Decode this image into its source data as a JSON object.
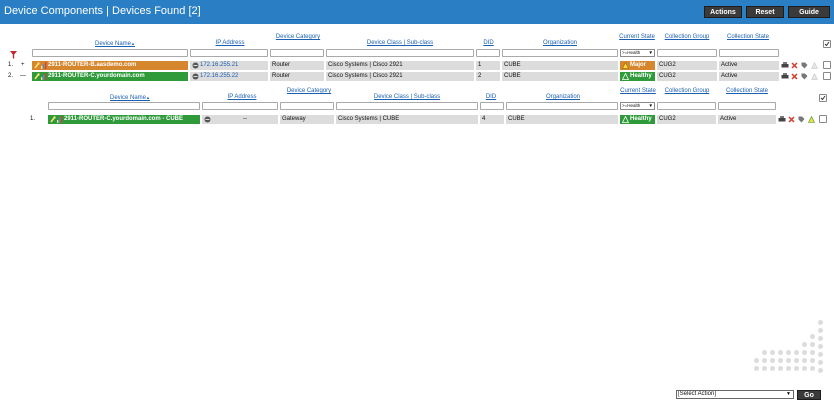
{
  "header": {
    "title": "Device Components | Devices Found [2]",
    "buttons": {
      "actions": "Actions",
      "reset": "Reset",
      "guide": "Guide"
    }
  },
  "table": {
    "columns": {
      "device_name": "Device Name",
      "sort_marker": "▲",
      "ip": "IP Address",
      "category": "Device Category",
      "class": "Device Class | Sub-class",
      "did": "DID",
      "org": "Organization",
      "current_state": "Current State",
      "collection_group": "Collection Group",
      "collection_state": "Collection State"
    },
    "state_filter": ">=Health",
    "rows": [
      {
        "num": "1.",
        "toggle": "+",
        "name": "2911-ROUTER-B.aasdemo.com",
        "ip": "172.16.255.21",
        "category": "Router",
        "class": "Cisco Systems | Cisco 2921",
        "did": "1",
        "org": "CUBE",
        "state": "Major",
        "group": "CUG2",
        "cstate": "Active"
      },
      {
        "num": "2.",
        "toggle": "—",
        "name": "2911-ROUTER-C.yourdomain.com",
        "ip": "172.16.255.22",
        "category": "Router",
        "class": "Cisco Systems | Cisco 2921",
        "did": "2",
        "org": "CUBE",
        "state": "Healthy",
        "group": "CUG2",
        "cstate": "Active"
      }
    ]
  },
  "subtable": {
    "columns": {
      "device_name": "Device Name",
      "sort_marker": "▲",
      "ip": "IP Address",
      "category": "Device Category",
      "class": "Device Class | Sub-class",
      "did": "DID",
      "org": "Organization",
      "current_state": "Current State",
      "collection_group": "Collection Group",
      "collection_state": "Collection State"
    },
    "state_filter": ">=Health",
    "rows": [
      {
        "num": "1.",
        "name": "2911-ROUTER-C.yourdomain.com - CUBE",
        "ip": "--",
        "category": "Gateway",
        "class": "Cisco Systems | CUBE",
        "did": "4",
        "org": "CUBE",
        "state": "Healthy",
        "group": "CUG2",
        "cstate": "Active"
      }
    ]
  },
  "footer": {
    "select_action": "[Select Action]",
    "go": "Go"
  },
  "colors": {
    "title_bar": "#2a7fc4",
    "major": "#d6862d",
    "healthy": "#2e9a3a",
    "link": "#1a5fb0"
  }
}
